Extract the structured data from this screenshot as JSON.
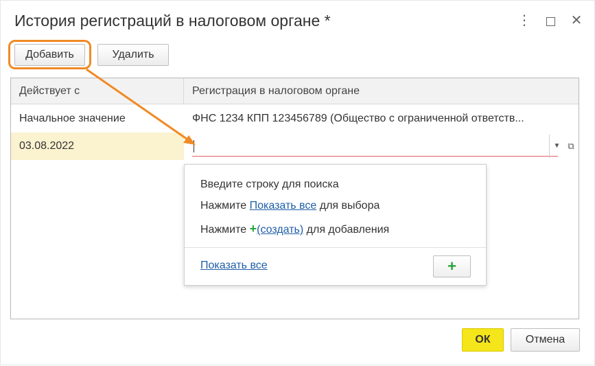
{
  "window": {
    "title": "История регистраций в налоговом органе *",
    "more_glyph": "⋮",
    "close_glyph": "✕"
  },
  "toolbar": {
    "add_label": "Добавить",
    "delete_label": "Удалить"
  },
  "table": {
    "columns": [
      "Действует с",
      "Регистрация в налоговом органе"
    ],
    "rows": [
      [
        "Начальное значение",
        "ФНС 1234 КПП 123456789 (Общество с ограниченной ответств..."
      ],
      [
        "03.08.2022",
        ""
      ]
    ]
  },
  "popup": {
    "line1": "Введите строку для поиска",
    "line2_prefix": "Нажмите ",
    "line2_link": "Показать все",
    "line2_suffix": " для выбора",
    "line3_prefix": "Нажмите ",
    "line3_plus": "+",
    "line3_link": "(создать)",
    "line3_suffix": " для добавления",
    "show_all": "Показать все",
    "add_plus": "+"
  },
  "footer": {
    "ok_label": "ОК",
    "cancel_label": "Отмена"
  },
  "colors": {
    "highlight": "#f08a24",
    "ok_button": "#f5e51b",
    "link": "#1e5ea8",
    "plus": "#27a33a",
    "selected_cell": "#fbf2cf"
  },
  "icons": {
    "dropdown": "chevron-down-icon",
    "open": "open-form-icon"
  }
}
